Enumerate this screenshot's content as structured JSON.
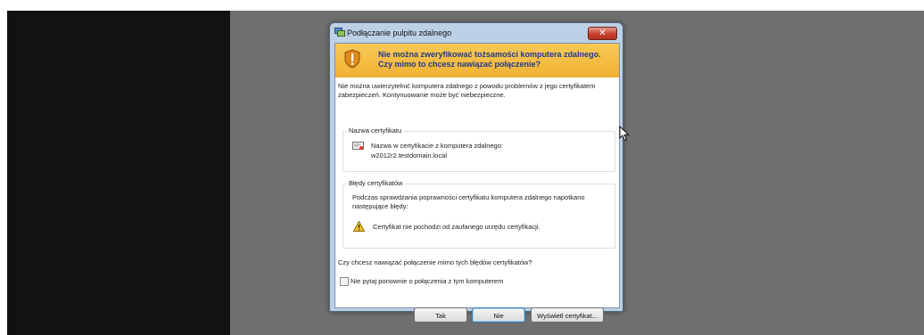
{
  "dialog": {
    "title": "Podłączanie pulpitu zdalnego",
    "close_label": "✕",
    "banner": {
      "line1": "Nie można zweryfikować tożsamości komputera zdalnego.",
      "line2": "Czy mimo to chcesz nawiązać połączenie?"
    },
    "description": "Nie można uwierzytelnić komputera zdalnego z powodu problemów z jego certyfikatem zabezpieczeń. Kontynuowanie może być niebezpieczne.",
    "certificate_name": {
      "legend": "Nazwa certyfikatu",
      "label": "Nazwa w certyfikacie z komputera zdalnego:",
      "value": "w2012r2.testdomain.local"
    },
    "certificate_errors": {
      "legend": "Błędy certyfikatów",
      "description": "Podczas sprawdzania poprawności certyfikatu komputera zdalnego napotkano następujące błędy:",
      "item": "Certyfikat nie pochodzi od zaufanego urzędu certyfikacji."
    },
    "question": "Czy chcesz nawiązać połączenie mimo tych błędów certyfikatów?",
    "checkbox_label": "Nie pytaj ponownie o połączenia z tym komputerem",
    "checkbox_checked": false,
    "buttons": {
      "yes": "Tak",
      "no": "Nie",
      "view": "Wyświetl certyfikat..."
    }
  },
  "icons": {
    "title": "remote-desktop-icon",
    "banner": "security-shield-icon",
    "certificate": "certificate-icon",
    "warning": "warning-triangle-icon",
    "cursor": "mouse-cursor-icon"
  },
  "colors": {
    "banner": "#f0b133",
    "banner_text": "#1e3a8a",
    "close_button": "#c6402b",
    "left_pane": "#121212",
    "right_pane": "#6f6f6f"
  }
}
